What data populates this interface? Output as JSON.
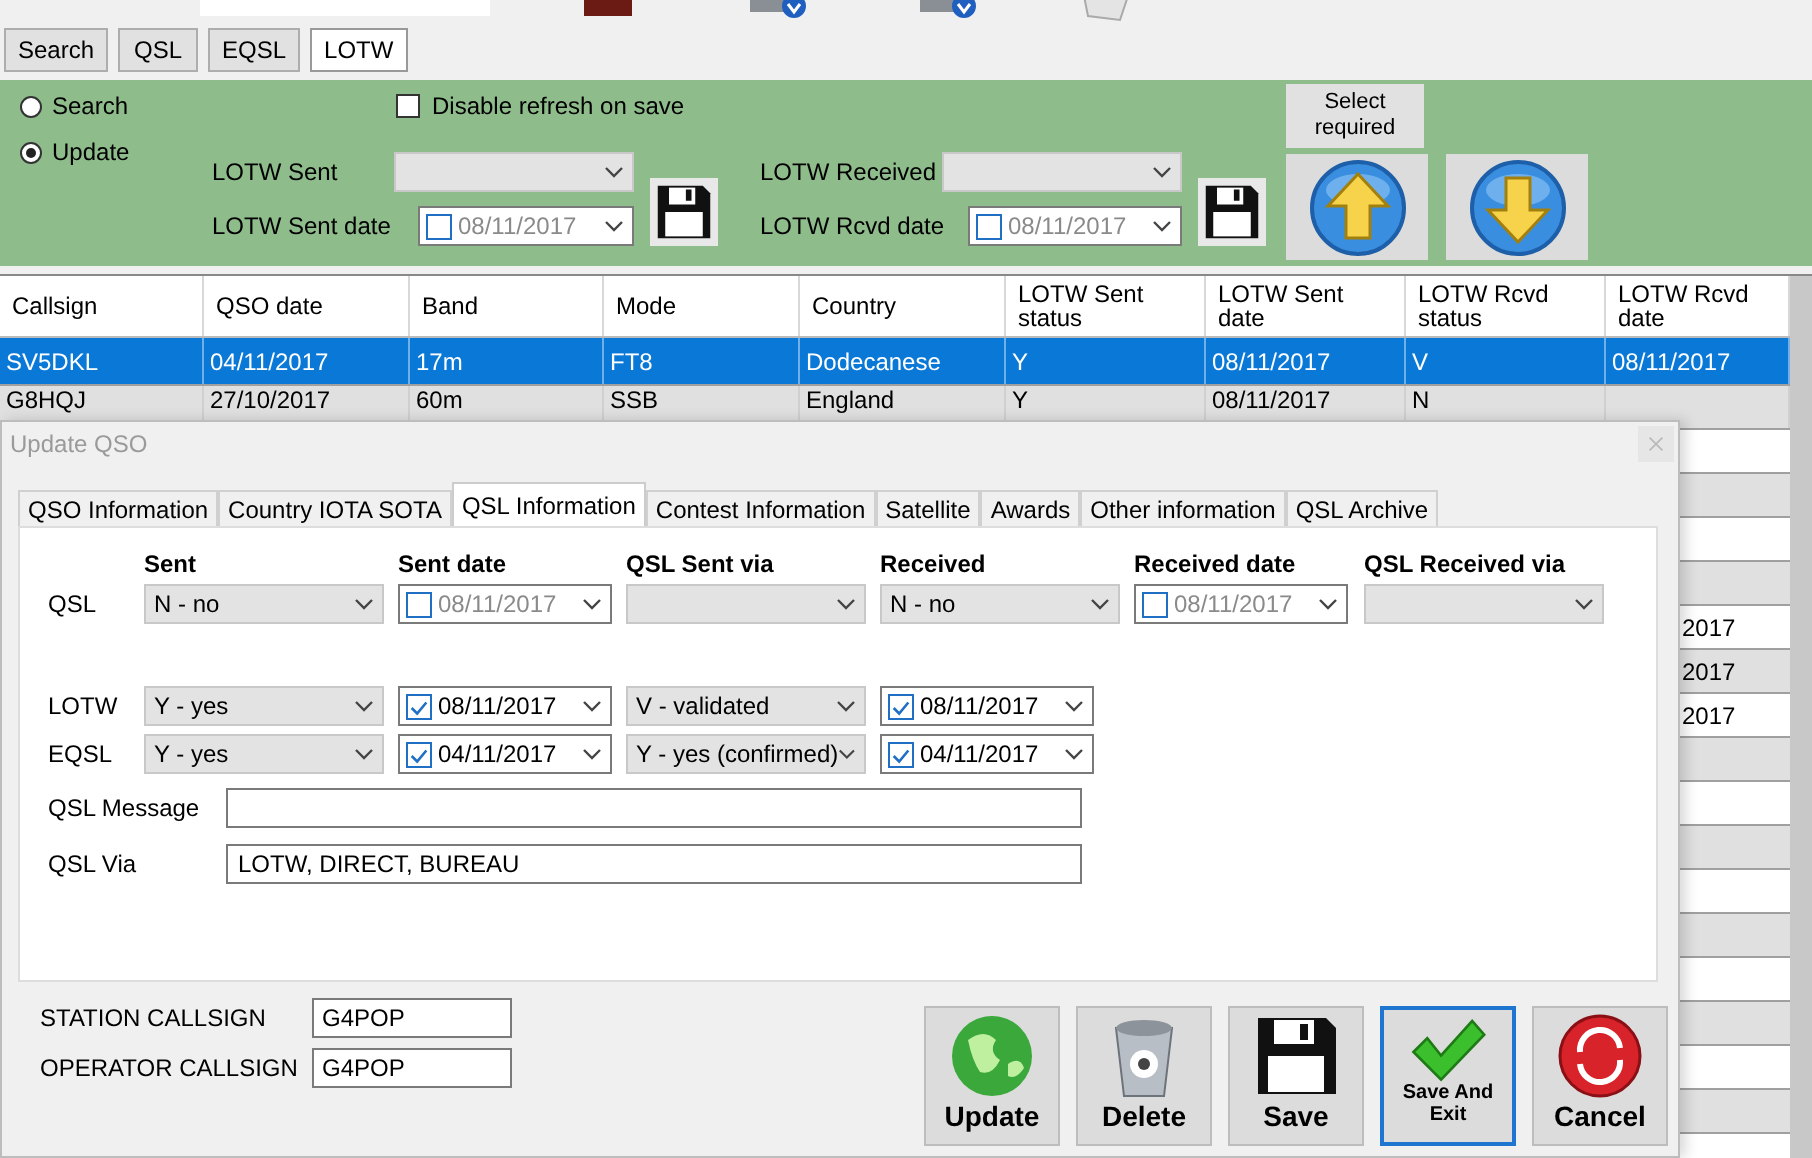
{
  "top_tabs": [
    {
      "label": "Search",
      "selected": false
    },
    {
      "label": "QSL",
      "selected": false
    },
    {
      "label": "EQSL",
      "selected": false
    },
    {
      "label": "LOTW",
      "selected": true
    }
  ],
  "filter_panel": {
    "modes": [
      {
        "label": "Search",
        "selected": false
      },
      {
        "label": "Update",
        "selected": true
      }
    ],
    "disable_refresh": {
      "label": "Disable refresh on save",
      "checked": false
    },
    "lotw_sent": {
      "label": "LOTW Sent"
    },
    "lotw_sent_date": {
      "label": "LOTW Sent date",
      "value": "08/11/2017",
      "checked": false
    },
    "lotw_received": {
      "label": "LOTW Received"
    },
    "lotw_rcvd_date": {
      "label": "LOTW Rcvd date",
      "value": "08/11/2017",
      "checked": false
    },
    "select_required": "Select required"
  },
  "grid": {
    "columns": [
      "Callsign",
      "QSO date",
      "Band",
      "Mode",
      "Country",
      "LOTW Sent status",
      "LOTW Sent date",
      "LOTW Rcvd status",
      "LOTW Rcvd date"
    ],
    "rows": [
      {
        "cells": [
          "SV5DKL",
          "04/11/2017",
          "17m",
          "FT8",
          "Dodecanese",
          "Y",
          "08/11/2017",
          "V",
          "08/11/2017"
        ],
        "selected": true
      },
      {
        "cells": [
          "G8HQJ",
          "27/10/2017",
          "60m",
          "SSB",
          "England",
          "Y",
          "08/11/2017",
          "N"
        ],
        "selected": false
      }
    ],
    "rows_behind_dialog": [
      {
        "last_cell": "2017"
      },
      {
        "last_cell": "2017"
      },
      {
        "last_cell": "2017"
      }
    ]
  },
  "dialog": {
    "title": "Update QSO",
    "tabs": [
      {
        "label": "QSO Information",
        "selected": false
      },
      {
        "label": "Country IOTA SOTA",
        "selected": false
      },
      {
        "label": "QSL Information",
        "selected": true
      },
      {
        "label": "Contest Information",
        "selected": false
      },
      {
        "label": "Satellite",
        "selected": false
      },
      {
        "label": "Awards",
        "selected": false
      },
      {
        "label": "Other information",
        "selected": false
      },
      {
        "label": "QSL Archive",
        "selected": false
      }
    ],
    "headers": [
      "Sent",
      "Sent date",
      "QSL Sent via",
      "Received",
      "Received date",
      "QSL Received via"
    ],
    "qsl_rows": [
      {
        "label": "QSL",
        "fields": [
          {
            "kind": "combo",
            "value": "N - no"
          },
          {
            "kind": "date",
            "value": "08/11/2017",
            "checked": false
          },
          {
            "kind": "combo"
          },
          {
            "kind": "combo",
            "value": "N - no"
          },
          {
            "kind": "date",
            "value": "08/11/2017",
            "checked": false
          },
          {
            "kind": "combo"
          }
        ]
      },
      {
        "label": "LOTW",
        "fields": [
          {
            "kind": "combo",
            "value": "Y - yes"
          },
          {
            "kind": "date",
            "value": "08/11/2017",
            "checked": true
          },
          {
            "kind": "combo",
            "value": "V - validated"
          },
          {
            "kind": "date",
            "value": "08/11/2017",
            "checked": true
          }
        ]
      },
      {
        "label": "EQSL",
        "fields": [
          {
            "kind": "combo",
            "value": "Y - yes"
          },
          {
            "kind": "date",
            "value": "04/11/2017",
            "checked": true
          },
          {
            "kind": "combo",
            "value": "Y - yes (confirmed)"
          },
          {
            "kind": "date",
            "value": "04/11/2017",
            "checked": true
          }
        ]
      }
    ],
    "message": {
      "label": "QSL Message"
    },
    "via": {
      "label": "QSL Via",
      "value": "LOTW, DIRECT, BUREAU"
    },
    "station_callsign": {
      "label": "STATION CALLSIGN",
      "value": "G4POP"
    },
    "operator_callsign": {
      "label": "OPERATOR CALLSIGN",
      "value": "G4POP"
    },
    "buttons": [
      {
        "label": "Update",
        "kind": "update",
        "focused": false
      },
      {
        "label": "Delete",
        "kind": "delete",
        "focused": false
      },
      {
        "label": "Save",
        "kind": "save",
        "focused": false
      },
      {
        "label": "Save And Exit",
        "kind": "save_exit",
        "focused": true
      },
      {
        "label": "Cancel",
        "kind": "cancel",
        "focused": false
      }
    ]
  }
}
